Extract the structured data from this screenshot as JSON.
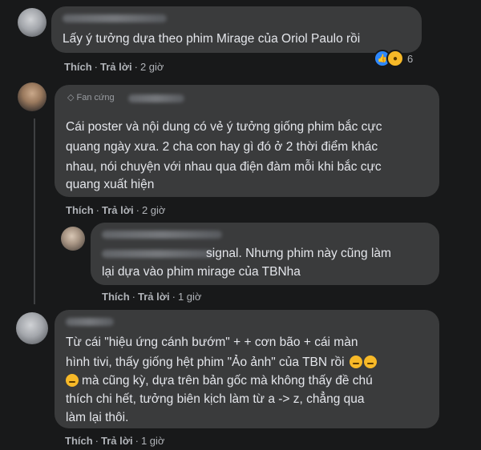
{
  "comments": [
    {
      "text_lines": [
        "Lấy ý tưởng dựa theo phim Mirage của Oriol Paulo rồi"
      ],
      "like": "Thích",
      "reply": "Trả lời",
      "time": "2 giờ",
      "reaction_count": "6"
    },
    {
      "badge": "Fan cứng",
      "text_lines": [
        "Cái poster và nội dung có vẻ ý tưởng giống phim bắc cực",
        "quang ngày xưa. 2 cha con hay gì đó ở 2 thời điểm khác",
        "nhau, nói chuyện với nhau qua điện đàm mỗi khi bắc cực",
        "quang xuất hiện"
      ],
      "like": "Thích",
      "reply": "Trả lời",
      "time": "2 giờ"
    },
    {
      "text_lines": [
        "signal. Nhưng phim này cũng làm",
        "lại dựa vào phim mirage của TBNha"
      ],
      "like": "Thích",
      "reply": "Trả lời",
      "time": "1 giờ"
    },
    {
      "text_lines": [
        "Từ cái \"hiệu ứng cánh bướm\" + + cơn bão + cái màn",
        "hình tivi, thấy giống hệt phim \"Ảo ảnh\" của TBN rồi",
        "mà cũng kỳ, dựa trên bản gốc mà không thấy đề chú",
        "thích chi hết, tưởng biên kịch làm từ a -> z, chẳng qua",
        "làm lại thôi."
      ],
      "like": "Thích",
      "reply": "Trả lời",
      "time": "1 giờ"
    }
  ]
}
